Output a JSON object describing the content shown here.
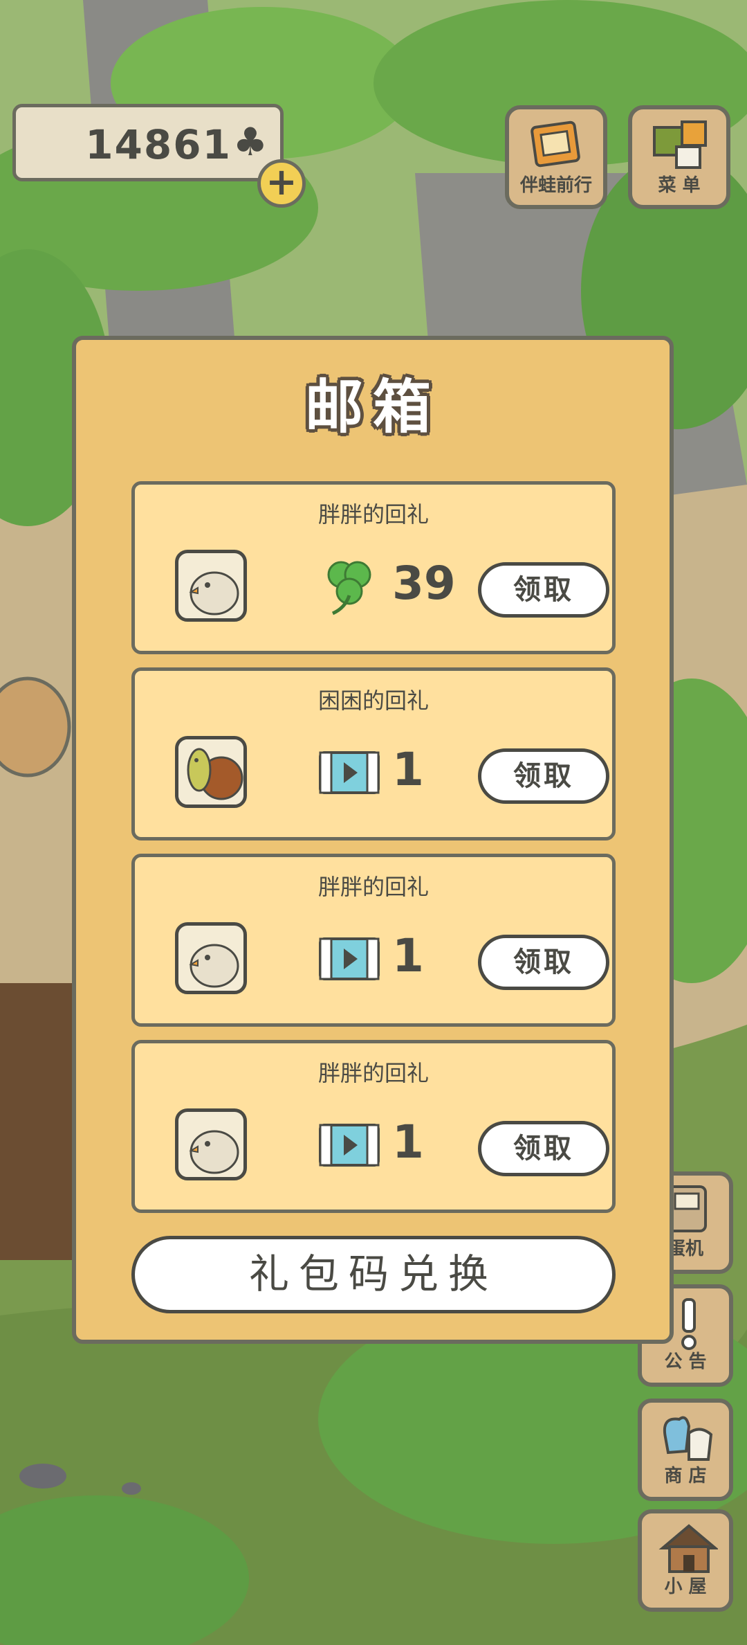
{
  "hud": {
    "clover_count": "14861",
    "clover_symbol": "♣",
    "plus_label": "+"
  },
  "top_buttons": [
    {
      "label": "伴蛙前行",
      "icon": "album-icon"
    },
    {
      "label": "菜 单",
      "icon": "menu-icon"
    }
  ],
  "side_buttons": [
    {
      "label": "蛋机",
      "icon": "gacha-icon"
    },
    {
      "label": "公 告",
      "icon": "notice-icon"
    },
    {
      "label": "商 店",
      "icon": "shop-icon"
    },
    {
      "label": "小 屋",
      "icon": "house-icon"
    }
  ],
  "mailbox": {
    "title": "邮箱",
    "items": [
      {
        "sender": "胖胖的回礼",
        "gift": "clover",
        "qty": "39",
        "claim_label": "领取"
      },
      {
        "sender": "困困的回礼",
        "gift": "film-ticket",
        "qty": "1",
        "claim_label": "领取"
      },
      {
        "sender": "胖胖的回礼",
        "gift": "film-ticket",
        "qty": "1",
        "claim_label": "领取"
      },
      {
        "sender": "胖胖的回礼",
        "gift": "film-ticket",
        "qty": "1",
        "claim_label": "领取"
      }
    ],
    "redeem_label": "礼包码兑换"
  },
  "colors": {
    "panel": "#edc474",
    "card": "#ffe09e",
    "outline": "#6b6b5e",
    "clover_green": "#5cb84c",
    "film_blue": "#7fd0dd"
  }
}
